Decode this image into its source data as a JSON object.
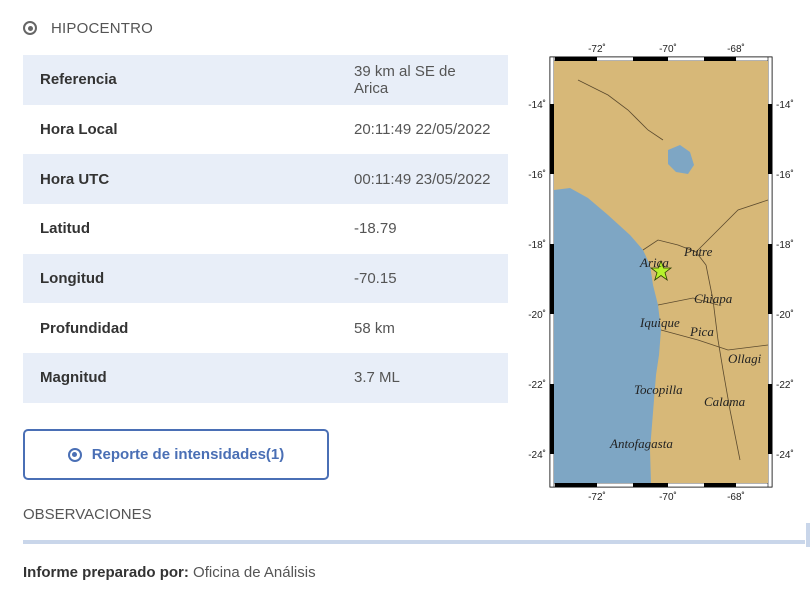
{
  "hipocentro": {
    "title": "HIPOCENTRO",
    "rows": [
      {
        "label": "Referencia",
        "value": "39 km al SE de Arica"
      },
      {
        "label": "Hora Local",
        "value": "20:11:49 22/05/2022"
      },
      {
        "label": "Hora UTC",
        "value": "00:11:49 23/05/2022"
      },
      {
        "label": "Latitud",
        "value": "-18.79"
      },
      {
        "label": "Longitud",
        "value": "-70.15"
      },
      {
        "label": "Profundidad",
        "value": "58 km"
      },
      {
        "label": "Magnitud",
        "value": "3.7 ML"
      }
    ]
  },
  "report_button": {
    "label": "Reporte de intensidades(1)"
  },
  "observaciones": {
    "title": "OBSERVACIONES"
  },
  "prepared": {
    "label": "Informe preparado por:",
    "value": "Oficina de Análisis"
  },
  "map": {
    "lon_ticks": [
      "-72˚",
      "-70˚",
      "-68˚"
    ],
    "lat_ticks": [
      "-14˚",
      "-16˚",
      "-18˚",
      "-20˚",
      "-22˚",
      "-24˚"
    ],
    "cities": [
      "Arica",
      "Putre",
      "Chiapa",
      "Iquique",
      "Pica",
      "Ollagi",
      "Tocopilla",
      "Calama",
      "Antofagasta"
    ],
    "colors": {
      "land": "#d7b878",
      "ocean": "#7ea6c4",
      "star": "#b6f22c"
    }
  }
}
